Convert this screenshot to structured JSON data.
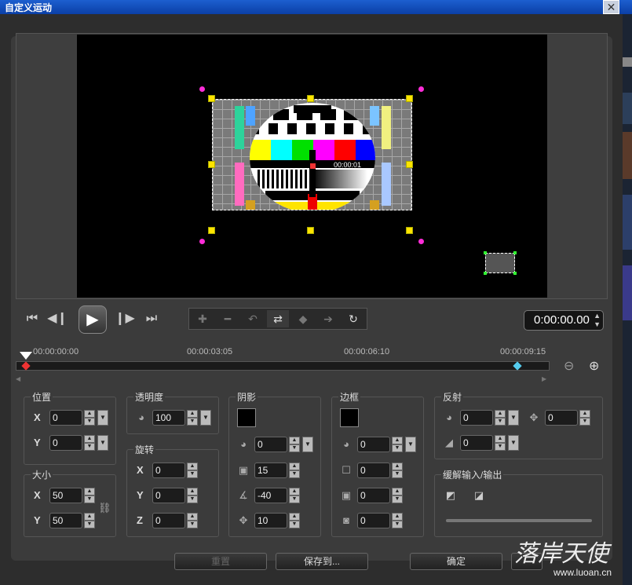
{
  "window": {
    "title": "自定义运动"
  },
  "preview": {
    "timecode_overlay": "00:00:01"
  },
  "transport": {
    "timecode": "0:00:00.00"
  },
  "ruler": {
    "labels": [
      "00:00:00:00",
      "00:00:03:05",
      "00:00:06:10",
      "00:00:09:15"
    ]
  },
  "position": {
    "title": "位置",
    "x_label": "X",
    "y_label": "Y",
    "x": "0",
    "y": "0"
  },
  "size": {
    "title": "大小",
    "x_label": "X",
    "y_label": "Y",
    "x": "50",
    "y": "50"
  },
  "opacity": {
    "title": "透明度",
    "value": "100"
  },
  "rotation": {
    "title": "旋转",
    "x_label": "X",
    "y_label": "Y",
    "z_label": "Z",
    "x": "0",
    "y": "0",
    "z": "0"
  },
  "shadow": {
    "title": "阴影",
    "opacity": "0",
    "blur": "15",
    "angle": "-40",
    "distance": "10"
  },
  "border": {
    "title": "边框",
    "v1": "0",
    "v2": "0",
    "v3": "0",
    "v4": "0"
  },
  "reflection": {
    "title": "反射",
    "v1": "0",
    "v2": "0",
    "v3": "0"
  },
  "ease": {
    "title": "缓解输入/输出"
  },
  "buttons": {
    "reset": "重置",
    "save_to": "保存到...",
    "ok": "确定"
  },
  "watermark": {
    "text": "落岸天使",
    "url": "www.luoan.cn"
  },
  "colors": {
    "handle": "#ffe400",
    "rotate_handle": "#ff2dd8",
    "accent": "#1d5fcf"
  }
}
